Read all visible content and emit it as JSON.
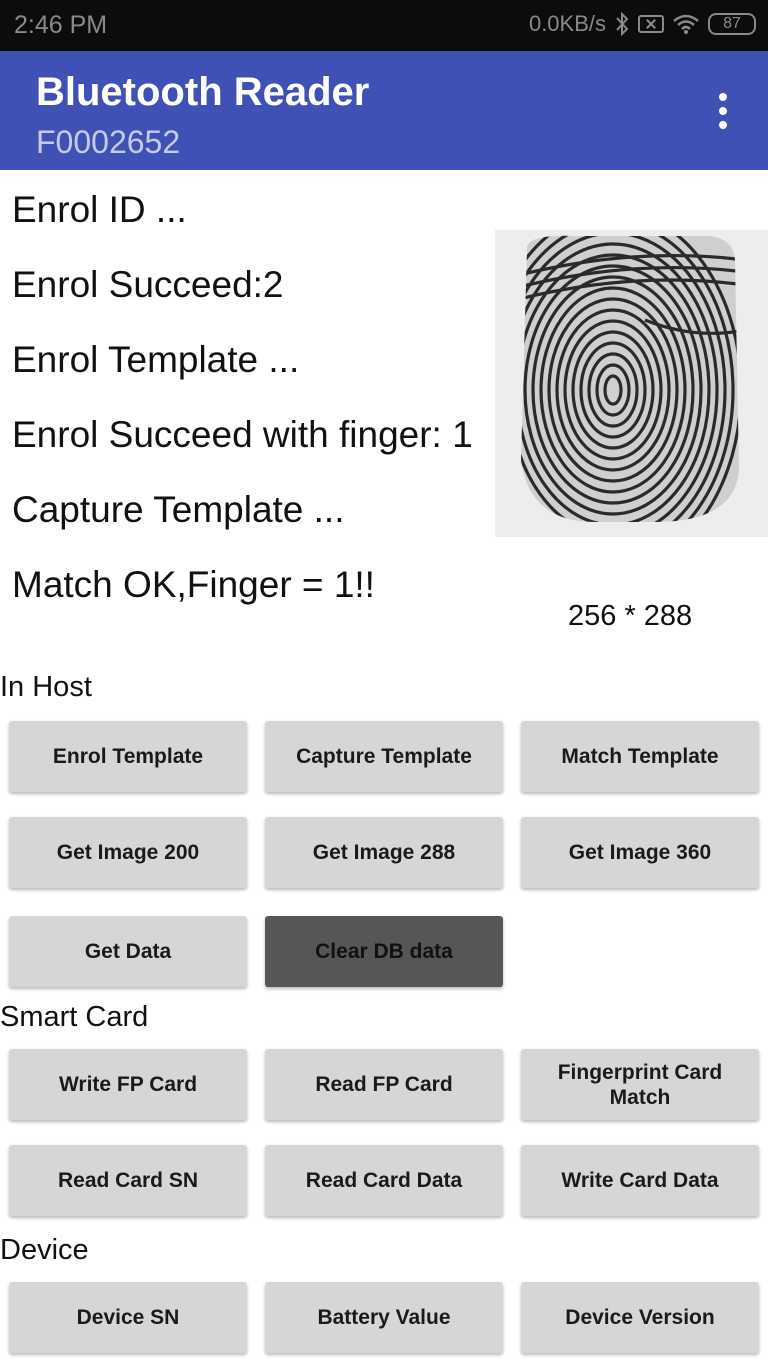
{
  "status_bar": {
    "time": "2:46 PM",
    "network_speed": "0.0KB/s",
    "battery_level": "87"
  },
  "app_bar": {
    "title": "Bluetooth Reader",
    "subtitle": "F0002652",
    "menu_icon": "more-vert-icon"
  },
  "log": [
    "Enrol ID ...",
    "Enrol Succeed:2",
    "Enrol Template ...",
    "Enrol Succeed with finger: 1",
    "Capture Template ...",
    "Match OK,Finger = 1!!"
  ],
  "fingerprint": {
    "icon": "fingerprint-image",
    "size_label": "256 * 288"
  },
  "sections": {
    "in_host": {
      "label": "In Host",
      "buttons": [
        "Enrol Template",
        "Capture Template",
        "Match Template",
        "Get Image 200",
        "Get Image 288",
        "Get Image 360",
        "Get Data",
        "Clear DB data"
      ]
    },
    "smart_card": {
      "label": "Smart Card",
      "buttons": [
        "Write FP Card",
        "Read FP Card",
        "Fingerprint Card Match",
        "Read Card SN",
        "Read Card Data",
        "Write Card Data"
      ]
    },
    "device": {
      "label": "Device",
      "buttons": [
        "Device SN",
        "Battery Value",
        "Device Version"
      ]
    }
  },
  "colors": {
    "app_bar": "#3f51b5",
    "button": "#d6d6d6",
    "button_pressed": "#565656"
  }
}
